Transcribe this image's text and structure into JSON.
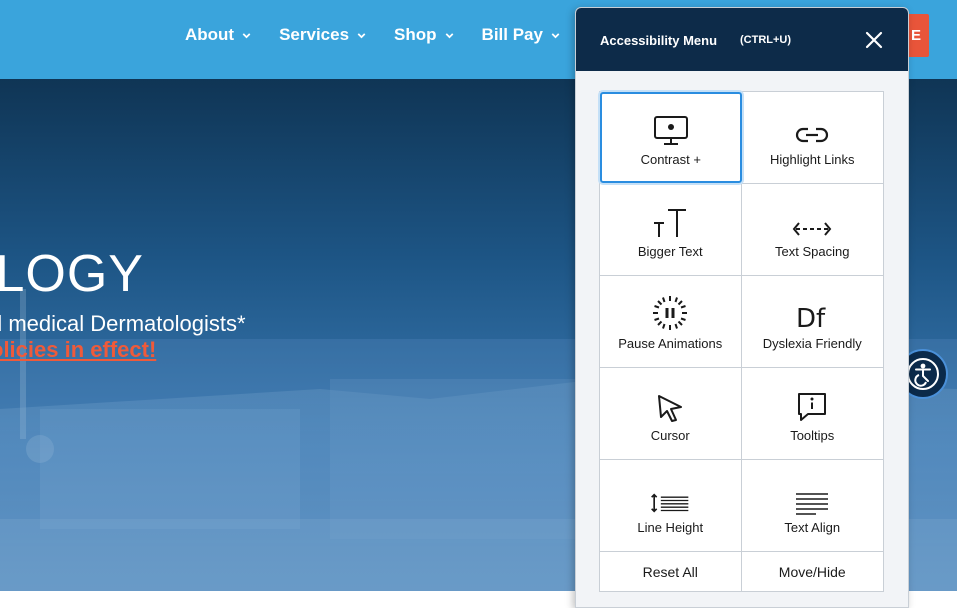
{
  "nav": {
    "items": [
      {
        "label": "About"
      },
      {
        "label": "Services"
      },
      {
        "label": "Shop"
      },
      {
        "label": "Bill Pay"
      }
    ],
    "cta_label": "E"
  },
  "hero": {
    "title": "OLOGY",
    "subtitle": "d medical Dermatologists*",
    "link": "olicies in effect!"
  },
  "a11y_menu": {
    "title": "Accessibility Menu",
    "shortcut": "(CTRL+U)",
    "options": [
      {
        "label": "Contrast +",
        "icon": "monitor-icon",
        "active": true
      },
      {
        "label": "Highlight Links",
        "icon": "link-icon"
      },
      {
        "label": "Bigger Text",
        "icon": "text-size-icon"
      },
      {
        "label": "Text Spacing",
        "icon": "text-spacing-icon"
      },
      {
        "label": "Pause Animations",
        "icon": "pause-icon"
      },
      {
        "label": "Dyslexia Friendly",
        "icon": "dyslexia-icon"
      },
      {
        "label": "Cursor",
        "icon": "cursor-icon"
      },
      {
        "label": "Tooltips",
        "icon": "tooltip-icon"
      },
      {
        "label": "Line Height",
        "icon": "line-height-icon"
      },
      {
        "label": "Text Align",
        "icon": "text-align-icon"
      }
    ],
    "reset_label": "Reset All",
    "move_label": "Move/Hide"
  },
  "colors": {
    "nav_bg": "#3aa4dc",
    "panel_header": "#0d2b49",
    "accent": "#e8553a",
    "active_border": "#2a8de0"
  }
}
